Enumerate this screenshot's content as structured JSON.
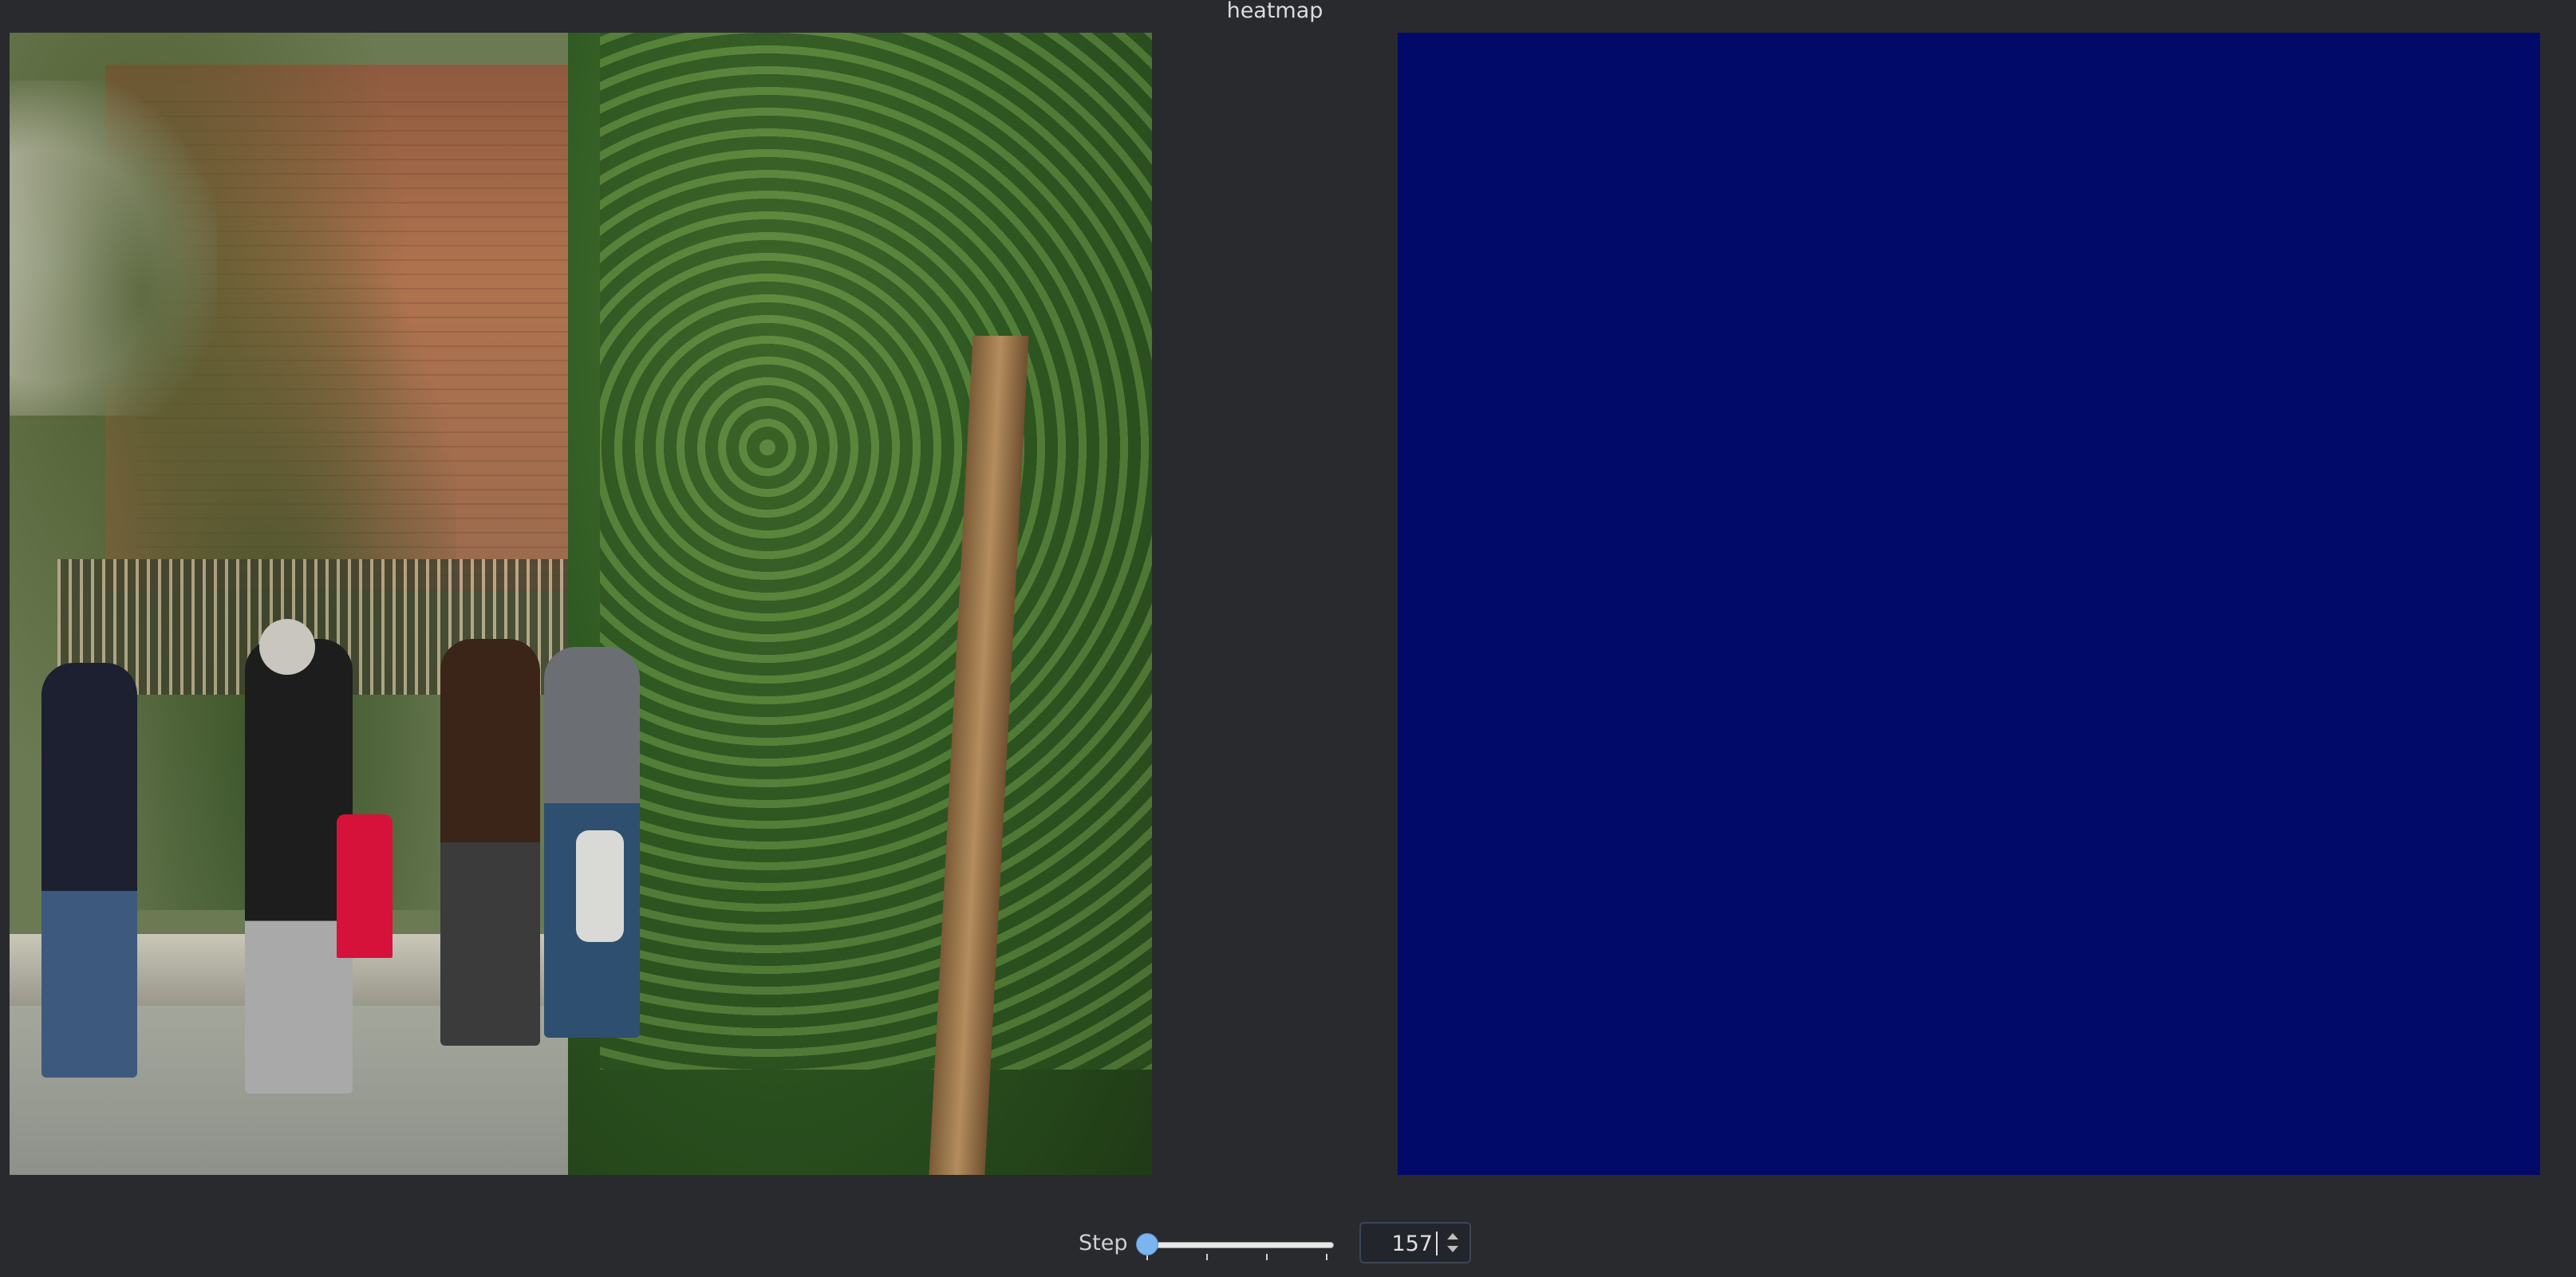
{
  "window": {
    "title": "heatmap"
  },
  "left_panel": {
    "kind": "photo"
  },
  "right_panel": {
    "kind": "heatmap",
    "fill_color": "#010a68"
  },
  "controls": {
    "step_label": "Step",
    "step_value": "157",
    "slider_ticks": 4
  }
}
